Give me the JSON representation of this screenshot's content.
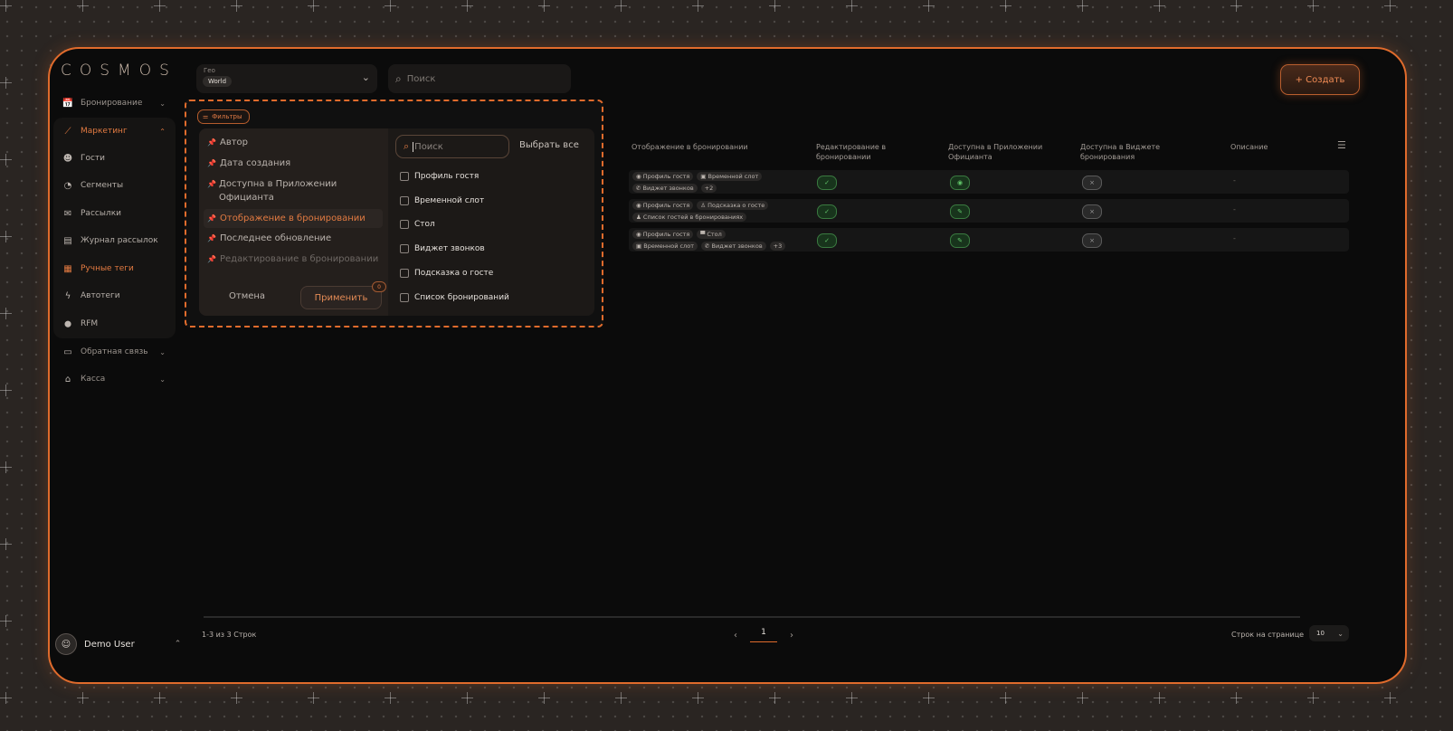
{
  "brand": {
    "logo": "COSMOS"
  },
  "sidebar": {
    "items": [
      {
        "label": "Бронирование",
        "icon": "calendar-plus-icon",
        "glyph": "📅",
        "chev": "⌄"
      },
      {
        "label": "Маркетинг",
        "icon": "chart-line-icon",
        "glyph": "⟋",
        "chev": "⌃"
      },
      {
        "label": "Гости",
        "icon": "smile-icon",
        "glyph": "☻"
      },
      {
        "label": "Сегменты",
        "icon": "pie-chart-icon",
        "glyph": "◔"
      },
      {
        "label": "Рассылки",
        "icon": "mail-icon",
        "glyph": "✉"
      },
      {
        "label": "Журнал рассылок",
        "icon": "chat-icon",
        "glyph": "▤"
      },
      {
        "label": "Ручные теги",
        "icon": "tags-icon",
        "glyph": "▦"
      },
      {
        "label": "Автотеги",
        "icon": "bolt-icon",
        "glyph": "ϟ"
      },
      {
        "label": "RFM",
        "icon": "location-pin-icon",
        "glyph": "⬤"
      },
      {
        "label": "Обратная связь",
        "icon": "feedback-icon",
        "glyph": "▭",
        "chev": "⌄"
      },
      {
        "label": "Касса",
        "icon": "cash-register-icon",
        "glyph": "⌂",
        "chev": "⌄"
      }
    ]
  },
  "user": {
    "name": "Demo User",
    "chev": "⌃"
  },
  "header": {
    "geo_label": "Гео",
    "geo_value": "World",
    "search_placeholder": "Поиск",
    "create_label": "+ Создать"
  },
  "filters": {
    "button_label": "Фильтры",
    "fields": [
      "Автор",
      "Дата создания",
      "Доступна в Приложении Официанта",
      "Отображение в бронировании",
      "Последнее обновление",
      "Редактирование в бронировании"
    ],
    "selected_field": "Отображение в бронировании",
    "cancel_label": "Отмена",
    "apply_label": "Применить",
    "apply_count": "0",
    "search_placeholder": "Поиск",
    "select_all_label": "Выбрать все",
    "options": [
      "Профиль гостя",
      "Временной слот",
      "Стол",
      "Виджет звонков",
      "Подсказка о госте",
      "Список бронирований"
    ]
  },
  "table": {
    "columns": [
      "Отображение в бронировании",
      "Редактирование в бронировании",
      "Доступна в Приложении Официанта",
      "Доступна в Виджете бронирования",
      "Описание"
    ],
    "rows": [
      {
        "line1": [
          {
            "icon": "user-icon",
            "glyph": "◉",
            "text": "Профиль гостя"
          },
          {
            "icon": "clock-icon",
            "glyph": "▣",
            "text": "Временной слот"
          }
        ],
        "line2": [
          {
            "icon": "phone-icon",
            "glyph": "✆",
            "text": "Виджет звонков"
          },
          {
            "icon": "",
            "glyph": "",
            "text": "+2"
          }
        ],
        "edit": "✓",
        "waiter": "◉",
        "widget": "×",
        "desc": "-"
      },
      {
        "line1": [
          {
            "icon": "user-icon",
            "glyph": "◉",
            "text": "Профиль гостя"
          },
          {
            "icon": "hint-icon",
            "glyph": "♙",
            "text": "Подсказка о госте"
          }
        ],
        "line2": [
          {
            "icon": "list-icon",
            "glyph": "♟",
            "text": "Список гостей в бронированиях"
          }
        ],
        "edit": "✓",
        "waiter": "✎",
        "widget": "×",
        "desc": "-"
      },
      {
        "line1": [
          {
            "icon": "user-icon",
            "glyph": "◉",
            "text": "Профиль гостя"
          },
          {
            "icon": "table-icon",
            "glyph": "▀",
            "text": "Стол"
          }
        ],
        "line2": [
          {
            "icon": "clock-icon",
            "glyph": "▣",
            "text": "Временной слот"
          },
          {
            "icon": "phone-icon",
            "glyph": "✆",
            "text": "Виджет звонков"
          },
          {
            "icon": "",
            "glyph": "",
            "text": "+3"
          }
        ],
        "edit": "✓",
        "waiter": "✎",
        "widget": "×",
        "desc": "-"
      }
    ]
  },
  "footer": {
    "count_text": "1-3 из 3 Строк",
    "prev": "‹",
    "page": "1",
    "next": "›",
    "rows_per_page_label": "Строк на странице",
    "rows_per_page_value": "10",
    "rows_chev": "⌄"
  }
}
